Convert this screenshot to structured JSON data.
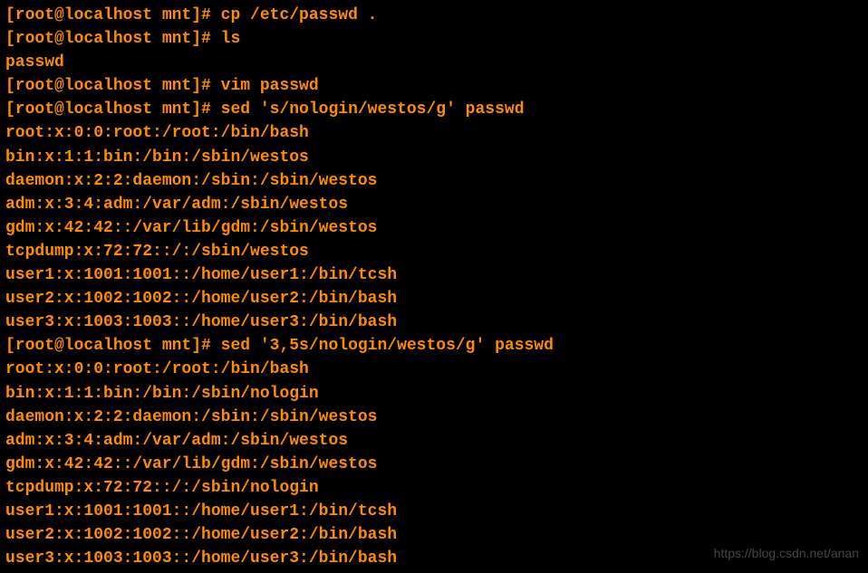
{
  "terminal": {
    "lines": [
      {
        "type": "prompt-cmd",
        "prompt": "[root@localhost mnt]# ",
        "command": "cp /etc/passwd ."
      },
      {
        "type": "prompt-cmd",
        "prompt": "[root@localhost mnt]# ",
        "command": "ls"
      },
      {
        "type": "output",
        "text": "passwd"
      },
      {
        "type": "prompt-cmd",
        "prompt": "[root@localhost mnt]# ",
        "command": "vim passwd"
      },
      {
        "type": "prompt-cmd",
        "prompt": "[root@localhost mnt]# ",
        "command": "sed 's/nologin/westos/g' passwd"
      },
      {
        "type": "output",
        "text": "root:x:0:0:root:/root:/bin/bash"
      },
      {
        "type": "output",
        "text": "bin:x:1:1:bin:/bin:/sbin/westos"
      },
      {
        "type": "output",
        "text": "daemon:x:2:2:daemon:/sbin:/sbin/westos"
      },
      {
        "type": "output",
        "text": "adm:x:3:4:adm:/var/adm:/sbin/westos"
      },
      {
        "type": "output",
        "text": "gdm:x:42:42::/var/lib/gdm:/sbin/westos"
      },
      {
        "type": "output",
        "text": "tcpdump:x:72:72::/:/sbin/westos"
      },
      {
        "type": "output",
        "text": "user1:x:1001:1001::/home/user1:/bin/tcsh"
      },
      {
        "type": "output",
        "text": "user2:x:1002:1002::/home/user2:/bin/bash"
      },
      {
        "type": "output",
        "text": "user3:x:1003:1003::/home/user3:/bin/bash"
      },
      {
        "type": "prompt-cmd",
        "prompt": "[root@localhost mnt]# ",
        "command": "sed '3,5s/nologin/westos/g' passwd"
      },
      {
        "type": "output",
        "text": "root:x:0:0:root:/root:/bin/bash"
      },
      {
        "type": "output",
        "text": "bin:x:1:1:bin:/bin:/sbin/nologin"
      },
      {
        "type": "output",
        "text": "daemon:x:2:2:daemon:/sbin:/sbin/westos"
      },
      {
        "type": "output",
        "text": "adm:x:3:4:adm:/var/adm:/sbin/westos"
      },
      {
        "type": "output",
        "text": "gdm:x:42:42::/var/lib/gdm:/sbin/westos"
      },
      {
        "type": "output",
        "text": "tcpdump:x:72:72::/:/sbin/nologin"
      },
      {
        "type": "output",
        "text": "user1:x:1001:1001::/home/user1:/bin/tcsh"
      },
      {
        "type": "output",
        "text": "user2:x:1002:1002::/home/user2:/bin/bash"
      },
      {
        "type": "output",
        "text": "user3:x:1003:1003::/home/user3:/bin/bash"
      }
    ]
  },
  "watermark": "https://blog.csdn.net/anan"
}
